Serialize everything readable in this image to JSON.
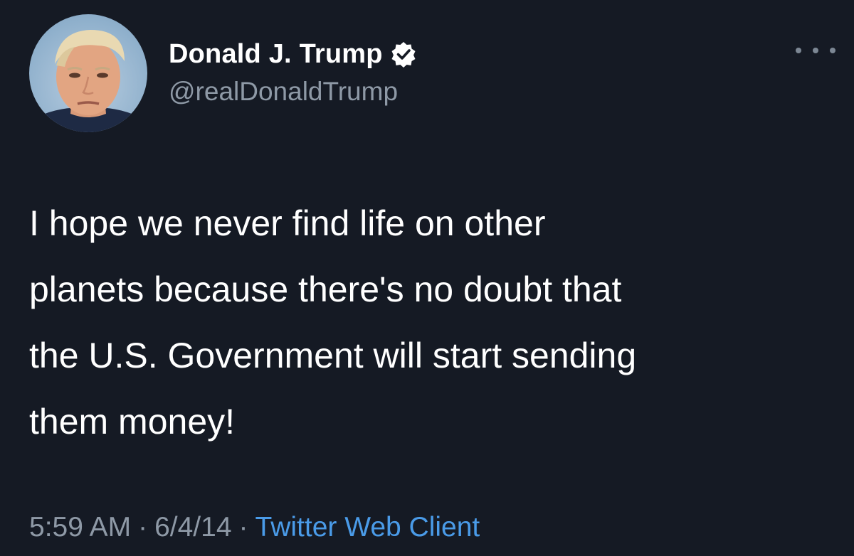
{
  "tweet": {
    "display_name": "Donald J. Trump",
    "handle": "@realDonaldTrump",
    "verified": true,
    "text": "I hope we never find life on other\nplanets because there's no doubt that\nthe U.S. Government will start sending\nthem money!",
    "time": "5:59 AM",
    "separator": "·",
    "date": "6/4/14",
    "client": "Twitter Web Client"
  },
  "icons": {
    "verified": "verified-badge-icon",
    "more": "more-options-icon"
  },
  "colors": {
    "background": "#151a24",
    "primary_text": "#ffffff",
    "secondary_text": "#8e99a6",
    "link": "#4a9be8"
  }
}
